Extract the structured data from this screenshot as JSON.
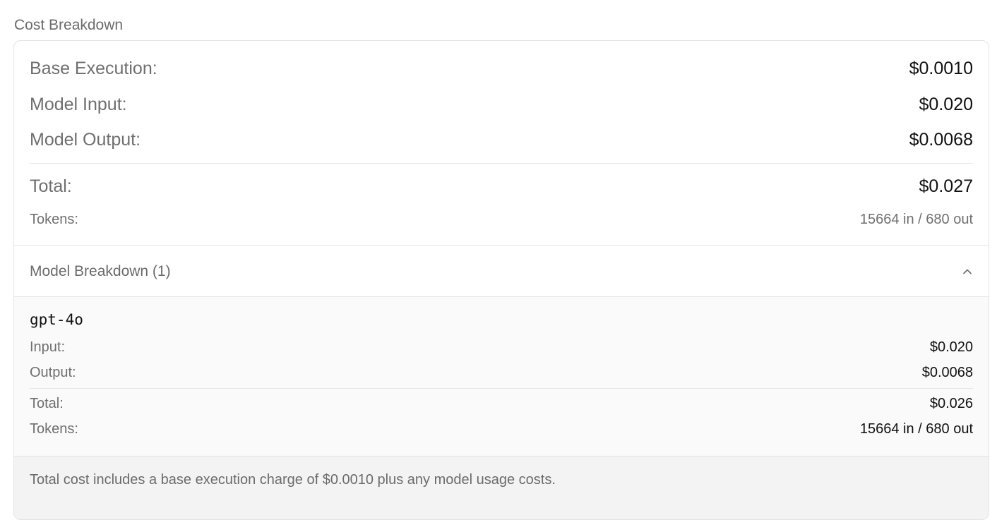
{
  "section_title": "Cost Breakdown",
  "summary": {
    "base_execution": {
      "label": "Base Execution:",
      "value": "$0.0010"
    },
    "model_input": {
      "label": "Model Input:",
      "value": "$0.020"
    },
    "model_output": {
      "label": "Model Output:",
      "value": "$0.0068"
    },
    "total": {
      "label": "Total:",
      "value": "$0.027"
    },
    "tokens": {
      "label": "Tokens:",
      "value": "15664 in / 680 out"
    }
  },
  "model_breakdown": {
    "title": "Model Breakdown (1)",
    "expanded": true,
    "toggle_icon": "chevron-up-icon",
    "models": [
      {
        "name": "gpt-4o",
        "input": {
          "label": "Input:",
          "value": "$0.020"
        },
        "output": {
          "label": "Output:",
          "value": "$0.0068"
        },
        "total": {
          "label": "Total:",
          "value": "$0.026"
        },
        "tokens": {
          "label": "Tokens:",
          "value": "15664 in / 680 out"
        }
      }
    ]
  },
  "footer_note": "Total cost includes a base execution charge of $0.0010 plus any model usage costs."
}
